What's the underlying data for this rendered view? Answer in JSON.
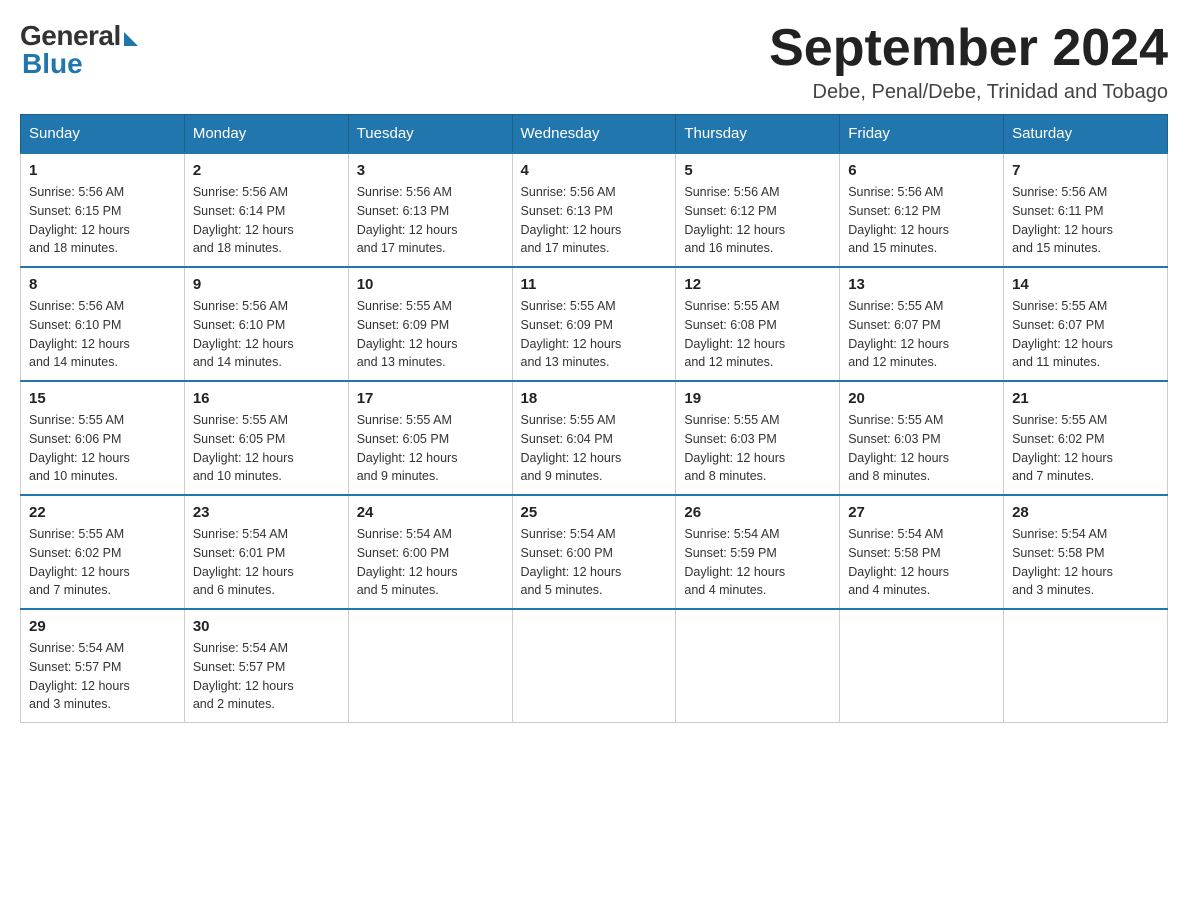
{
  "header": {
    "logo_general": "General",
    "logo_blue": "Blue",
    "month_title": "September 2024",
    "location": "Debe, Penal/Debe, Trinidad and Tobago"
  },
  "days_of_week": [
    "Sunday",
    "Monday",
    "Tuesday",
    "Wednesday",
    "Thursday",
    "Friday",
    "Saturday"
  ],
  "weeks": [
    [
      {
        "day": "1",
        "sunrise": "5:56 AM",
        "sunset": "6:15 PM",
        "daylight": "12 hours and 18 minutes."
      },
      {
        "day": "2",
        "sunrise": "5:56 AM",
        "sunset": "6:14 PM",
        "daylight": "12 hours and 18 minutes."
      },
      {
        "day": "3",
        "sunrise": "5:56 AM",
        "sunset": "6:13 PM",
        "daylight": "12 hours and 17 minutes."
      },
      {
        "day": "4",
        "sunrise": "5:56 AM",
        "sunset": "6:13 PM",
        "daylight": "12 hours and 17 minutes."
      },
      {
        "day": "5",
        "sunrise": "5:56 AM",
        "sunset": "6:12 PM",
        "daylight": "12 hours and 16 minutes."
      },
      {
        "day": "6",
        "sunrise": "5:56 AM",
        "sunset": "6:12 PM",
        "daylight": "12 hours and 15 minutes."
      },
      {
        "day": "7",
        "sunrise": "5:56 AM",
        "sunset": "6:11 PM",
        "daylight": "12 hours and 15 minutes."
      }
    ],
    [
      {
        "day": "8",
        "sunrise": "5:56 AM",
        "sunset": "6:10 PM",
        "daylight": "12 hours and 14 minutes."
      },
      {
        "day": "9",
        "sunrise": "5:56 AM",
        "sunset": "6:10 PM",
        "daylight": "12 hours and 14 minutes."
      },
      {
        "day": "10",
        "sunrise": "5:55 AM",
        "sunset": "6:09 PM",
        "daylight": "12 hours and 13 minutes."
      },
      {
        "day": "11",
        "sunrise": "5:55 AM",
        "sunset": "6:09 PM",
        "daylight": "12 hours and 13 minutes."
      },
      {
        "day": "12",
        "sunrise": "5:55 AM",
        "sunset": "6:08 PM",
        "daylight": "12 hours and 12 minutes."
      },
      {
        "day": "13",
        "sunrise": "5:55 AM",
        "sunset": "6:07 PM",
        "daylight": "12 hours and 12 minutes."
      },
      {
        "day": "14",
        "sunrise": "5:55 AM",
        "sunset": "6:07 PM",
        "daylight": "12 hours and 11 minutes."
      }
    ],
    [
      {
        "day": "15",
        "sunrise": "5:55 AM",
        "sunset": "6:06 PM",
        "daylight": "12 hours and 10 minutes."
      },
      {
        "day": "16",
        "sunrise": "5:55 AM",
        "sunset": "6:05 PM",
        "daylight": "12 hours and 10 minutes."
      },
      {
        "day": "17",
        "sunrise": "5:55 AM",
        "sunset": "6:05 PM",
        "daylight": "12 hours and 9 minutes."
      },
      {
        "day": "18",
        "sunrise": "5:55 AM",
        "sunset": "6:04 PM",
        "daylight": "12 hours and 9 minutes."
      },
      {
        "day": "19",
        "sunrise": "5:55 AM",
        "sunset": "6:03 PM",
        "daylight": "12 hours and 8 minutes."
      },
      {
        "day": "20",
        "sunrise": "5:55 AM",
        "sunset": "6:03 PM",
        "daylight": "12 hours and 8 minutes."
      },
      {
        "day": "21",
        "sunrise": "5:55 AM",
        "sunset": "6:02 PM",
        "daylight": "12 hours and 7 minutes."
      }
    ],
    [
      {
        "day": "22",
        "sunrise": "5:55 AM",
        "sunset": "6:02 PM",
        "daylight": "12 hours and 7 minutes."
      },
      {
        "day": "23",
        "sunrise": "5:54 AM",
        "sunset": "6:01 PM",
        "daylight": "12 hours and 6 minutes."
      },
      {
        "day": "24",
        "sunrise": "5:54 AM",
        "sunset": "6:00 PM",
        "daylight": "12 hours and 5 minutes."
      },
      {
        "day": "25",
        "sunrise": "5:54 AM",
        "sunset": "6:00 PM",
        "daylight": "12 hours and 5 minutes."
      },
      {
        "day": "26",
        "sunrise": "5:54 AM",
        "sunset": "5:59 PM",
        "daylight": "12 hours and 4 minutes."
      },
      {
        "day": "27",
        "sunrise": "5:54 AM",
        "sunset": "5:58 PM",
        "daylight": "12 hours and 4 minutes."
      },
      {
        "day": "28",
        "sunrise": "5:54 AM",
        "sunset": "5:58 PM",
        "daylight": "12 hours and 3 minutes."
      }
    ],
    [
      {
        "day": "29",
        "sunrise": "5:54 AM",
        "sunset": "5:57 PM",
        "daylight": "12 hours and 3 minutes."
      },
      {
        "day": "30",
        "sunrise": "5:54 AM",
        "sunset": "5:57 PM",
        "daylight": "12 hours and 2 minutes."
      },
      null,
      null,
      null,
      null,
      null
    ]
  ],
  "labels": {
    "sunrise": "Sunrise:",
    "sunset": "Sunset:",
    "daylight": "Daylight:"
  }
}
